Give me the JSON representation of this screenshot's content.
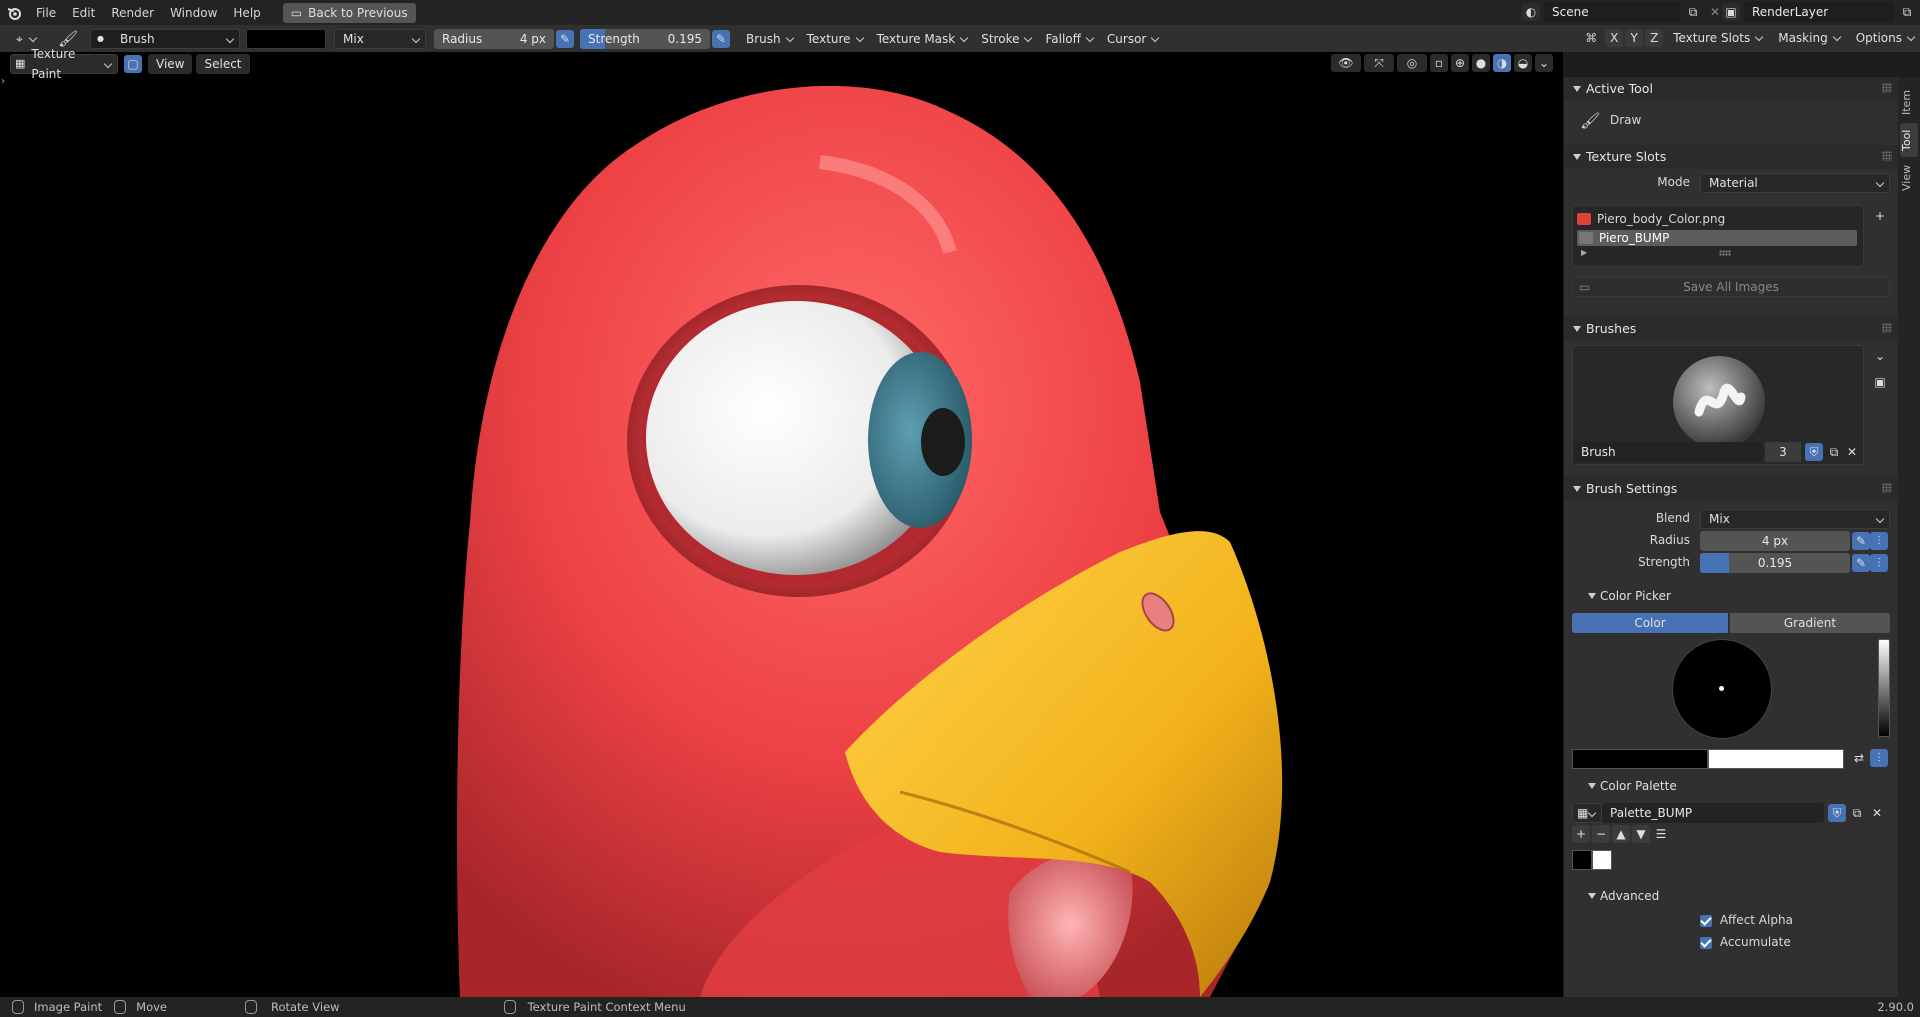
{
  "menu": {
    "items": [
      "File",
      "Edit",
      "Render",
      "Window",
      "Help"
    ],
    "back_button": "Back to Previous"
  },
  "scene": {
    "label": "Scene",
    "render_layer": "RenderLayer"
  },
  "tool_header": {
    "brush_name": "Brush",
    "blend": "Mix",
    "radius_label": "Radius",
    "radius_value": "4 px",
    "strength_label": "Strength",
    "strength_value": "0.195",
    "menus": [
      "Brush",
      "Texture",
      "Texture Mask",
      "Stroke",
      "Falloff",
      "Cursor"
    ],
    "right_axes": [
      "X",
      "Y",
      "Z"
    ],
    "right_menus": [
      "Texture Slots",
      "Masking",
      "Options"
    ]
  },
  "viewport_header": {
    "mode": "Texture Paint",
    "menus": [
      "View",
      "Select"
    ]
  },
  "sidebar_tabs": [
    "Item",
    "Tool",
    "View"
  ],
  "active_tool": {
    "title": "Active Tool",
    "tool": "Draw"
  },
  "texture_slots": {
    "title": "Texture Slots",
    "mode_label": "Mode",
    "mode_value": "Material",
    "slots": [
      "Piero_body_Color.png",
      "Piero_BUMP"
    ],
    "save_all": "Save All Images"
  },
  "brushes": {
    "title": "Brushes",
    "name": "Brush",
    "users": "3"
  },
  "brush_settings": {
    "title": "Brush Settings",
    "blend_label": "Blend",
    "blend_value": "Mix",
    "radius_label": "Radius",
    "radius_value": "4 px",
    "strength_label": "Strength",
    "strength_value": "0.195",
    "strength_fraction": 0.195
  },
  "color_picker": {
    "title": "Color Picker",
    "tabs": [
      "Color",
      "Gradient"
    ],
    "primary": "#000000",
    "secondary": "#ffffff"
  },
  "color_palette": {
    "title": "Color Palette",
    "name": "Palette_BUMP",
    "swatches": [
      "#000000",
      "#ffffff"
    ]
  },
  "advanced": {
    "title": "Advanced",
    "options": [
      "Affect Alpha",
      "Accumulate"
    ]
  },
  "status": {
    "items": [
      "Image Paint",
      "Move",
      "Rotate View",
      "Texture Paint Context Menu"
    ],
    "version": "2.90.0"
  },
  "colors": {
    "accent": "#4772b3",
    "parrot_red": "#ee4245",
    "beak_yellow": "#f2b21b",
    "iris": "#3f7f92"
  }
}
